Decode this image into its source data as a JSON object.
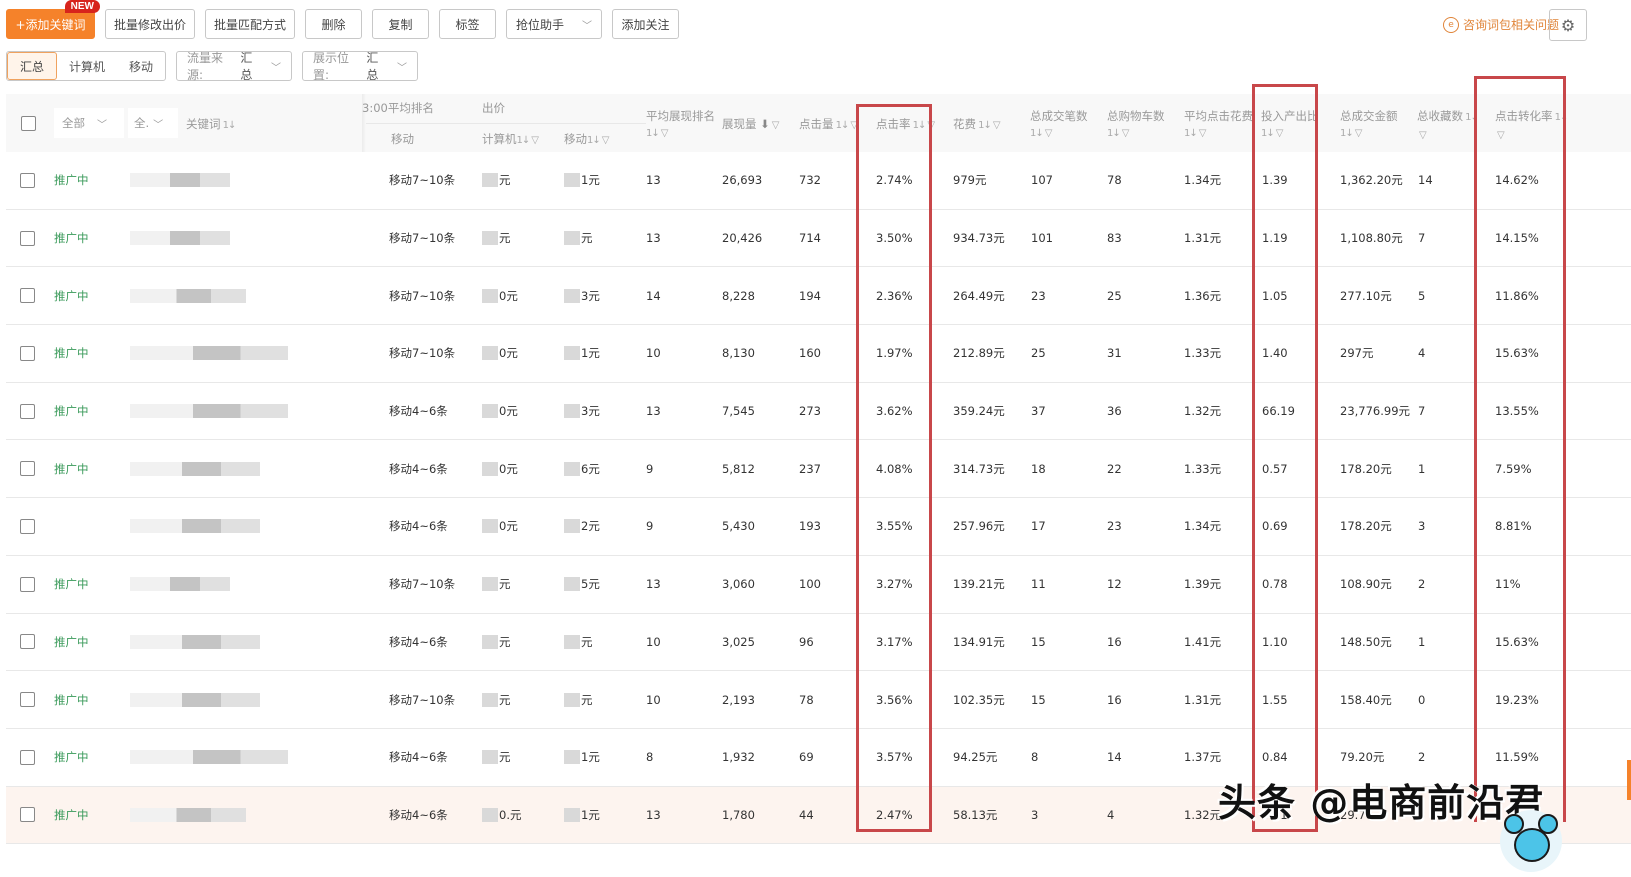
{
  "toolbar": {
    "add_keyword": "+添加关键词",
    "new_badge": "NEW",
    "batch_bid": "批量修改出价",
    "batch_match": "批量匹配方式",
    "delete": "删除",
    "copy": "复制",
    "tag": "标签",
    "rank_assistant": "抢位助手",
    "add_follow": "添加关注",
    "help_link": "咨询词包相关问题",
    "settings_icon": "gear-icon"
  },
  "filters": {
    "device_tabs": [
      "汇总",
      "计算机",
      "移动"
    ],
    "device_active": "汇总",
    "traffic_source_label": "流量来源:",
    "traffic_source_value": "汇总",
    "display_position_label": "展示位置:",
    "display_position_value": "汇总"
  },
  "table": {
    "header": {
      "status_filter": "全部",
      "match_filter": "全.",
      "keyword": "关键词",
      "avg_rank_group": "3:00平均排名",
      "avg_rank_mobile": "移动",
      "bid_group": "出价",
      "bid_pc": "计算机",
      "bid_mobile": "移动",
      "avg_display_rank": "平均展现排名",
      "impressions": "展现量",
      "clicks": "点击量",
      "ctr": "点击率",
      "cost": "花费",
      "total_orders": "总成交笔数",
      "total_cart": "总购物车数",
      "avg_cpc": "平均点击花费",
      "roi": "投入产出比",
      "total_gmv": "总成交金额",
      "total_fav": "总收藏数",
      "cvr": "点击转化率"
    },
    "rows": [
      {
        "status": "推广中",
        "rank": "移动7~10条",
        "bid_pc": "元",
        "bid_mobile": "1元",
        "avg_display_rank": "13",
        "impressions": "26,693",
        "clicks": "732",
        "ctr": "2.74%",
        "cost": "979元",
        "orders": "107",
        "cart": "78",
        "cpc": "1.34元",
        "roi": "1.39",
        "gmv": "1,362.20元",
        "fav": "14",
        "cvr": "14.62%"
      },
      {
        "status": "推广中",
        "rank": "移动7~10条",
        "bid_pc": "元",
        "bid_mobile": "元",
        "avg_display_rank": "13",
        "impressions": "20,426",
        "clicks": "714",
        "ctr": "3.50%",
        "cost": "934.73元",
        "orders": "101",
        "cart": "83",
        "cpc": "1.31元",
        "roi": "1.19",
        "gmv": "1,108.80元",
        "fav": "7",
        "cvr": "14.15%"
      },
      {
        "status": "推广中",
        "rank": "移动7~10条",
        "bid_pc": "0元",
        "bid_mobile": "3元",
        "avg_display_rank": "14",
        "impressions": "8,228",
        "clicks": "194",
        "ctr": "2.36%",
        "cost": "264.49元",
        "orders": "23",
        "cart": "25",
        "cpc": "1.36元",
        "roi": "1.05",
        "gmv": "277.10元",
        "fav": "5",
        "cvr": "11.86%"
      },
      {
        "status": "推广中",
        "rank": "移动7~10条",
        "bid_pc": "0元",
        "bid_mobile": "1元",
        "avg_display_rank": "10",
        "impressions": "8,130",
        "clicks": "160",
        "ctr": "1.97%",
        "cost": "212.89元",
        "orders": "25",
        "cart": "31",
        "cpc": "1.33元",
        "roi": "1.40",
        "gmv": "297元",
        "fav": "4",
        "cvr": "15.63%"
      },
      {
        "status": "推广中",
        "rank": "移动4~6条",
        "bid_pc": "0元",
        "bid_mobile": "3元",
        "avg_display_rank": "13",
        "impressions": "7,545",
        "clicks": "273",
        "ctr": "3.62%",
        "cost": "359.24元",
        "orders": "37",
        "cart": "36",
        "cpc": "1.32元",
        "roi": "66.19",
        "gmv": "23,776.99元",
        "fav": "7",
        "cvr": "13.55%"
      },
      {
        "status": "推广中",
        "rank": "移动4~6条",
        "bid_pc": "0元",
        "bid_mobile": "6元",
        "avg_display_rank": "9",
        "impressions": "5,812",
        "clicks": "237",
        "ctr": "4.08%",
        "cost": "314.73元",
        "orders": "18",
        "cart": "22",
        "cpc": "1.33元",
        "roi": "0.57",
        "gmv": "178.20元",
        "fav": "1",
        "cvr": "7.59%"
      },
      {
        "status": "",
        "rank": "移动4~6条",
        "bid_pc": "0元",
        "bid_mobile": "2元",
        "avg_display_rank": "9",
        "impressions": "5,430",
        "clicks": "193",
        "ctr": "3.55%",
        "cost": "257.96元",
        "orders": "17",
        "cart": "23",
        "cpc": "1.34元",
        "roi": "0.69",
        "gmv": "178.20元",
        "fav": "3",
        "cvr": "8.81%"
      },
      {
        "status": "推广中",
        "rank": "移动7~10条",
        "bid_pc": "元",
        "bid_mobile": "5元",
        "avg_display_rank": "13",
        "impressions": "3,060",
        "clicks": "100",
        "ctr": "3.27%",
        "cost": "139.21元",
        "orders": "11",
        "cart": "12",
        "cpc": "1.39元",
        "roi": "0.78",
        "gmv": "108.90元",
        "fav": "2",
        "cvr": "11%"
      },
      {
        "status": "推广中",
        "rank": "移动4~6条",
        "bid_pc": "元",
        "bid_mobile": "元",
        "avg_display_rank": "10",
        "impressions": "3,025",
        "clicks": "96",
        "ctr": "3.17%",
        "cost": "134.91元",
        "orders": "15",
        "cart": "16",
        "cpc": "1.41元",
        "roi": "1.10",
        "gmv": "148.50元",
        "fav": "1",
        "cvr": "15.63%"
      },
      {
        "status": "推广中",
        "rank": "移动7~10条",
        "bid_pc": "元",
        "bid_mobile": "元",
        "avg_display_rank": "10",
        "impressions": "2,193",
        "clicks": "78",
        "ctr": "3.56%",
        "cost": "102.35元",
        "orders": "15",
        "cart": "16",
        "cpc": "1.31元",
        "roi": "1.55",
        "gmv": "158.40元",
        "fav": "0",
        "cvr": "19.23%"
      },
      {
        "status": "推广中",
        "rank": "移动4~6条",
        "bid_pc": "元",
        "bid_mobile": "1元",
        "avg_display_rank": "8",
        "impressions": "1,932",
        "clicks": "69",
        "ctr": "3.57%",
        "cost": "94.25元",
        "orders": "8",
        "cart": "14",
        "cpc": "1.37元",
        "roi": "0.84",
        "gmv": "79.20元",
        "fav": "2",
        "cvr": "11.59%"
      },
      {
        "status": "推广中",
        "rank": "移动4~6条",
        "bid_pc": "0.元",
        "bid_mobile": "1元",
        "avg_display_rank": "13",
        "impressions": "1,780",
        "clicks": "44",
        "ctr": "2.47%",
        "cost": "58.13元",
        "orders": "3",
        "cart": "4",
        "cpc": "1.32元",
        "roi": "0.81",
        "gmv": "29.70元",
        "fav": "3",
        "cvr": ""
      }
    ]
  },
  "watermark": "头条 @电商前沿君"
}
